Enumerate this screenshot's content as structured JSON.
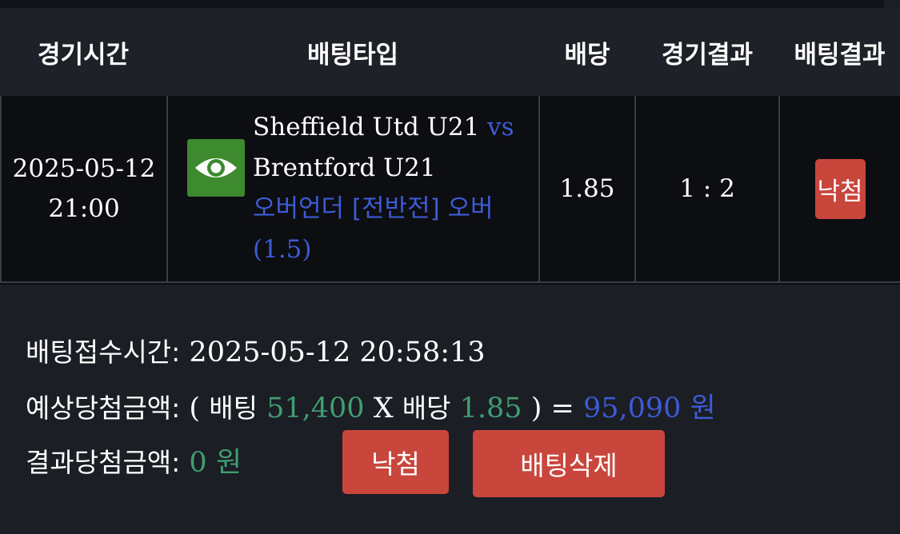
{
  "table": {
    "headers": {
      "time": "경기시간",
      "bet_type": "배팅타입",
      "odds": "배당",
      "game_result": "경기결과",
      "bet_result": "배팅결과"
    },
    "row": {
      "date": "2025-05-12",
      "time": "21:00",
      "home": "Sheffield Utd U21",
      "vs": "vs",
      "away": "Brentford U21",
      "market_line1": "오버언더 [전반전] 오버",
      "market_line2": "(1.5)",
      "odds": "1.85",
      "score": "1 : 2",
      "result_badge": "낙첨",
      "icon": "eye-icon"
    }
  },
  "summary": {
    "accept_label": "배팅접수시간:",
    "accept_value": "2025-05-12 20:58:13",
    "expected_label": "예상당첨금액:",
    "open_paren": "(",
    "bet_word": "배팅",
    "bet_amount": "51,400",
    "times": "X",
    "odds_word": "배당",
    "odds_value": "1.85",
    "close_paren_eq": ") =",
    "expected_amount": "95,090 원",
    "result_label": "결과당첨금액:",
    "result_amount": "0 원"
  },
  "buttons": {
    "status": "낙첨",
    "delete": "배팅삭제"
  },
  "colors": {
    "background": "#1b1e24",
    "accent_red": "#c9463d",
    "blue": "#3d5bd6",
    "green": "#3f9e73",
    "icon_green": "#3e8a2f"
  }
}
